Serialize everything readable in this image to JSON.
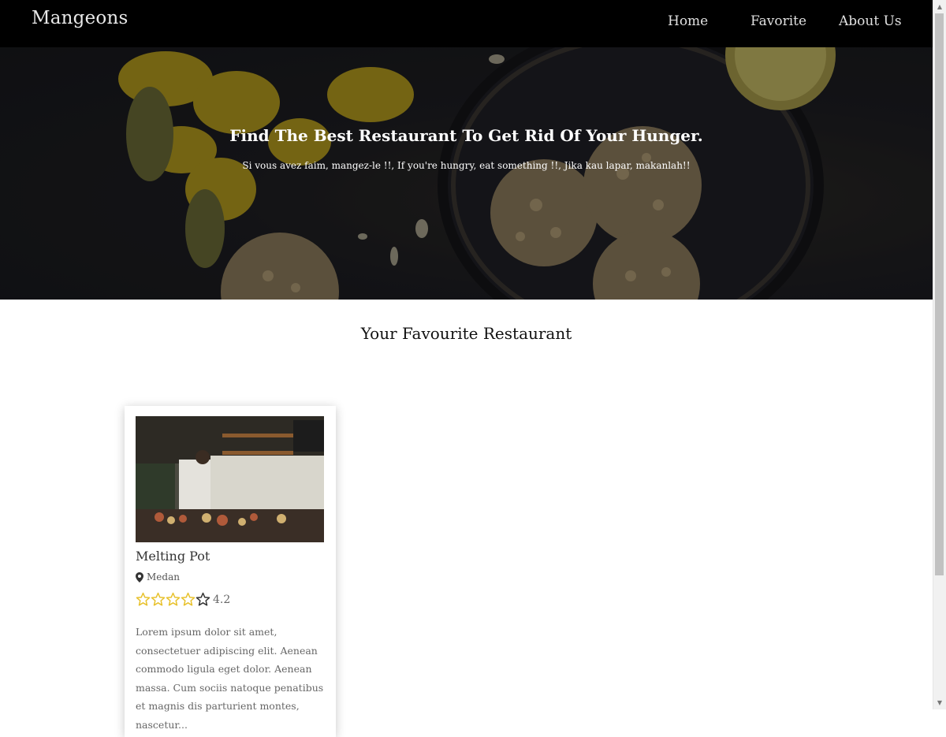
{
  "header": {
    "brand": "Mangeons",
    "nav": [
      {
        "label": "Home"
      },
      {
        "label": "Favorite"
      },
      {
        "label": "About Us"
      }
    ]
  },
  "hero": {
    "title": "Find The Best Restaurant To Get Rid Of Your Hunger.",
    "subtitle": "Si vous avez faim, mangez-le !!, If you're hungry, eat something !!, Jika kau lapar, makanlah!!"
  },
  "section": {
    "title": "Your Favourite Restaurant"
  },
  "restaurants": [
    {
      "name": "Melting Pot",
      "city": "Medan",
      "rating": "4.2",
      "rating_value": 4.2,
      "rating_max": 5,
      "description": "Lorem ipsum dolor sit amet, consectetuer adipiscing elit. Aenean commodo ligula eget dolor. Aenean massa. Cum sociis natoque penatibus et magnis dis parturient montes, nascetur..."
    }
  ],
  "icons": {
    "location": "map-marker-icon",
    "star": "star-icon"
  },
  "colors": {
    "navbar": "#000000",
    "star": "#e8c22e",
    "star_empty": "#333333"
  }
}
